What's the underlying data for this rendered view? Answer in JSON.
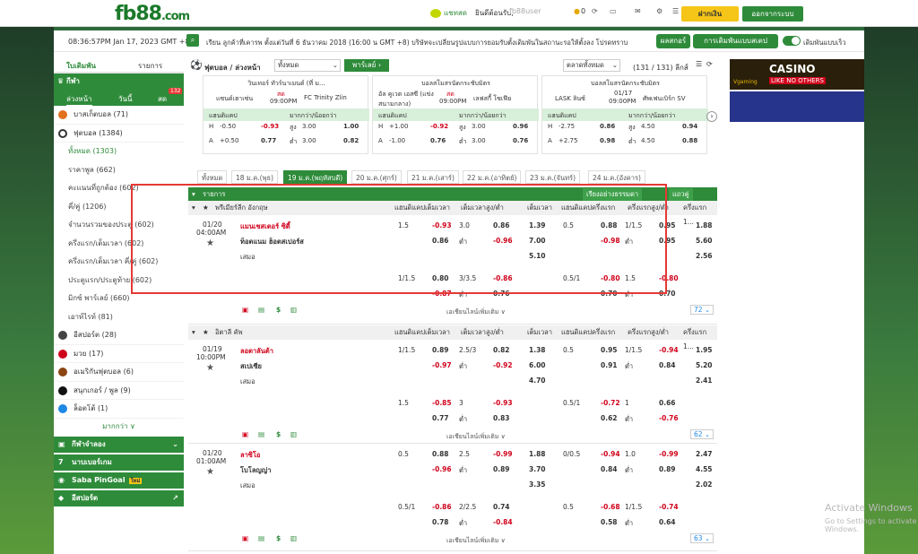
{
  "header": {
    "logo": "fb88",
    "logo_suffix": ".com",
    "chat": "แชทสด",
    "greeting": "ยินดีต้อนรับ,",
    "username": "fb88user",
    "balance": "0",
    "deposit": "ฝากเงิน",
    "logout": "ออกจากระบบ"
  },
  "info": {
    "datetime": "08:36:57PM Jan 17, 2023 GMT +8",
    "notice": "เรียน ลูกค้าที่เคารพ ตั้งแต่วันที่ 6 ธันวาคม 2018 (16:00 น GMT +8) บริษัทจะเปลี่ยนรูปแบบการยอมรับตั้งเดิมพันในสถานะรอให้ตั้งลง โปรดทราบ",
    "btn1": "ผลสกอร์",
    "btn2": "การเดิมพันแบบสเตป",
    "toggle": "เดิมพันแบบเร็ว"
  },
  "side": {
    "tab1": "ใบเดิมพัน",
    "tab2": "รายการ",
    "sports": "กีฬา",
    "t1": "ล่วงหน้า",
    "t2": "วันนี้",
    "t3": "สด",
    "live_count": "132",
    "items": [
      {
        "label": "บาสเก็ตบอล (71)"
      },
      {
        "label": "ฟุตบอล (1384)"
      }
    ],
    "subs": [
      "ทั้งหมด (1303)",
      "ราคาพูล (662)",
      "คะแนนที่ถูกต้อง (602)",
      "คี่/คู่ (1206)",
      "จำนวนรวมของประตู (602)",
      "ครึ่งแรก/เต็มเวลา (602)",
      "ครึ่งแรก/เต็มเวลา คี่/คู่ (602)",
      "ประตูแรก/ประตูท้าย (602)",
      "มิกซ์ พาร์เลย์ (660)",
      "เอาท์ไรท์ (81)"
    ],
    "items2": [
      "อีสปอร์ต (28)",
      "มวย (17)",
      "อเมริกันฟุตบอล (6)",
      "สนุกเกอร์ / พูล (9)",
      "ล็อตโต้ (1)"
    ],
    "more": "มากกว่า ∨",
    "groups": [
      "กีฬาจำลอง",
      "นาบเบอร์เกม",
      "Saba PinGoal",
      "อีสปอร์ต"
    ],
    "new": "ใหม่"
  },
  "main": {
    "sport": "ฟุตบอล / ล่วงหน้า",
    "filter": "ทั้งหมด",
    "parlay": "พาร์เลย์ ›",
    "market": "ตลาดทั้งหมด",
    "leagues": "(131 / 131) ลีกส์",
    "cards": [
      {
        "league": "วินเทอร์ ทัวร์นาเมนต์ (ที่ ม...",
        "home": "แซนด์เฮาเซ่น",
        "status": "สด",
        "time": "09:00PM",
        "away": "FC Trinity Zlin",
        "h1": "แฮนดิแคป",
        "h2": "มากกว่า/น้อยกว่า",
        "r1": [
          "H",
          "-0.50",
          "-0.93",
          "สูง",
          "3.00",
          "1.00"
        ],
        "r2": [
          "A",
          "+0.50",
          "0.77",
          "ต่ำ",
          "3.00",
          "0.82"
        ]
      },
      {
        "league": "บอลสโมสรนัดกระชับมิตร",
        "home": "อัล คูเวต เอสซี (แข่งสนามกลาง)",
        "status": "สด",
        "time": "09:00PM",
        "away": "เลฟสกี้ โซเฟีย",
        "h1": "แฮนดิแคป",
        "h2": "มากกว่า/น้อยกว่า",
        "r1": [
          "H",
          "+1.00",
          "-0.92",
          "สูง",
          "3.00",
          "0.96"
        ],
        "r2": [
          "A",
          "-1.00",
          "0.76",
          "ต่ำ",
          "3.00",
          "0.76"
        ]
      },
      {
        "league": "บอลสโมสรนัดกระชับมิตร",
        "home": "LASK ลินซ์",
        "status": "01/17",
        "time": "09:00PM",
        "away": "ศัพเฟนเบิร์ก SV",
        "h1": "แฮนดิแคป",
        "h2": "มากกว่า/น้อยกว่า",
        "r1": [
          "H",
          "-2.75",
          "0.86",
          "สูง",
          "4.50",
          "0.94"
        ],
        "r2": [
          "A",
          "+2.75",
          "0.98",
          "ต่ำ",
          "4.50",
          "0.88"
        ]
      }
    ],
    "dates": [
      "ทั้งหมด",
      "18 ม.ค.(พุธ)",
      "19 ม.ค.(พฤหัสบดี)",
      "20 ม.ค.(ศุกร์)",
      "21 ม.ค.(เสาร์)",
      "22 ม.ค.(อาทิตย์)",
      "23 ม.ค.(จันทร์)",
      "24 ม.ค.(อังคาร)"
    ],
    "list_title": "รายการ",
    "sort": "เรียงอย่างธรรมดา",
    "dual": "แถวคู่",
    "cols": [
      "แฮนดิแคปเต็มเวลา",
      "เต็มเวลาสูง/ต่ำ",
      "เต็มเวลา",
      "แฮนดิแคปครึ่งแรก",
      "ครึ่งแรกสูง/ต่ำ",
      "ครึ่งแรก 1..."
    ],
    "more_bets": "เอเชียนไลน์เพิ่มเติม ∨",
    "matches": [
      {
        "league": "พรีเมียร์ลีก อังกฤษ",
        "date": "01/20",
        "time": "04:00AM",
        "home": "แมนเชสเตอร์ ซิตี้",
        "away": "ท็อตแนม ฮ็อตสเปอร์ส",
        "draw": "เสมอ",
        "count": "72",
        "r1": [
          "1.5",
          "-0.93",
          "3.0",
          "0.86",
          "1.39",
          "0.5",
          "0.88",
          "1/1.5",
          "0.95",
          "1.88"
        ],
        "r2": [
          "",
          "0.86",
          "ต่ำ",
          "-0.96",
          "7.00",
          "",
          "-0.98",
          "ต่ำ",
          "0.95",
          "5.60"
        ],
        "r3": [
          "",
          "",
          "",
          "",
          "5.10",
          "",
          "",
          "",
          "",
          "2.56"
        ],
        "r4": [
          "1/1.5",
          "0.80",
          "3/3.5",
          "-0.86",
          "",
          "0.5/1",
          "-0.80",
          "1.5",
          "-0.80",
          ""
        ],
        "r5": [
          "",
          "-0.87",
          "ต่ำ",
          "0.76",
          "",
          "",
          "0.70",
          "ต่ำ",
          "0.70",
          ""
        ]
      },
      {
        "league": "อิตาลี คัพ",
        "date": "01/19",
        "time": "10:00PM",
        "home": "ลอตาลันต้า",
        "away": "สเปเซีย",
        "draw": "เสมอ",
        "count": "62",
        "r1": [
          "1/1.5",
          "0.89",
          "2.5/3",
          "0.82",
          "1.38",
          "0.5",
          "0.95",
          "1/1.5",
          "-0.94",
          "1.95"
        ],
        "r2": [
          "",
          "-0.97",
          "ต่ำ",
          "-0.92",
          "6.00",
          "",
          "0.91",
          "ต่ำ",
          "0.84",
          "5.20"
        ],
        "r3": [
          "",
          "",
          "",
          "",
          "4.70",
          "",
          "",
          "",
          "",
          "2.41"
        ],
        "r4": [
          "1.5",
          "-0.85",
          "3",
          "-0.93",
          "",
          "0.5/1",
          "-0.72",
          "1",
          "0.66",
          ""
        ],
        "r5": [
          "",
          "0.77",
          "ต่ำ",
          "0.83",
          "",
          "",
          "0.62",
          "ต่ำ",
          "-0.76",
          ""
        ]
      },
      {
        "league": "",
        "date": "01/20",
        "time": "01:00AM",
        "home": "ลาซิโอ",
        "away": "โบโลญญ่า",
        "draw": "เสมอ",
        "count": "63",
        "r1": [
          "0.5",
          "0.88",
          "2.5",
          "-0.99",
          "1.88",
          "0/0.5",
          "-0.94",
          "1.0",
          "-0.99",
          "2.47"
        ],
        "r2": [
          "",
          "-0.96",
          "ต่ำ",
          "0.89",
          "3.70",
          "",
          "0.84",
          "ต่ำ",
          "0.89",
          "4.55"
        ],
        "r3": [
          "",
          "",
          "",
          "",
          "3.35",
          "",
          "",
          "",
          "",
          "2.02"
        ],
        "r4": [
          "0.5/1",
          "-0.86",
          "2/2.5",
          "0.74",
          "",
          "0.5",
          "-0.68",
          "1/1.5",
          "-0.74",
          ""
        ],
        "r5": [
          "",
          "0.78",
          "ต่ำ",
          "-0.84",
          "",
          "",
          "0.58",
          "ต่ำ",
          "0.64",
          ""
        ]
      }
    ]
  },
  "ads": {
    "a1": "CASINO",
    "a1b": "LIKE NO OTHERS",
    "a1c": "Vgaming"
  },
  "windows": {
    "title": "Activate Windows",
    "sub": "Go to Settings to activate Windows."
  }
}
